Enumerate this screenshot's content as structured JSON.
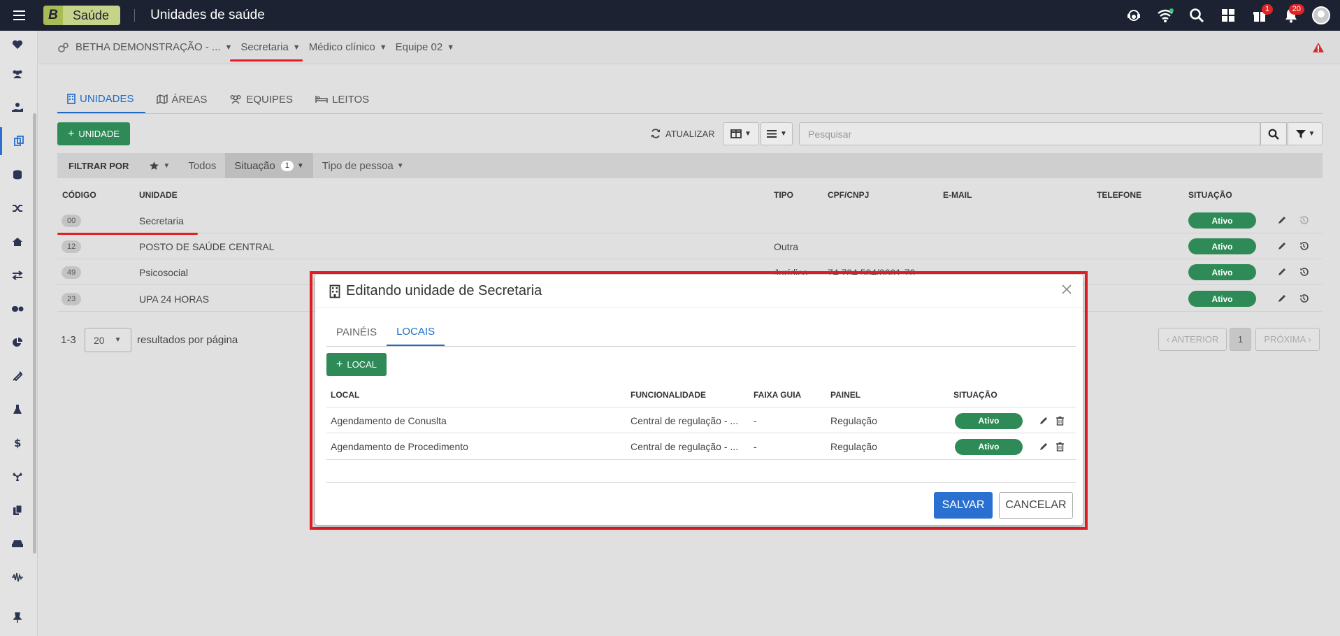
{
  "header": {
    "brand_letter": "B",
    "brand_name": "Saúde",
    "title": "Unidades de saúde",
    "icons": [
      "support-icon",
      "wifi-icon",
      "search-icon",
      "grid-icon",
      "gift-icon",
      "bell-icon"
    ],
    "gift_badge": "1",
    "bell_badge": "20"
  },
  "sidebar": {
    "items": [
      "heartbeat-icon",
      "users-icon",
      "hand-user-icon",
      "copy-icon",
      "database-icon",
      "random-icon",
      "home-icon",
      "exchange-icon",
      "pills-icon",
      "pie-chart-icon",
      "syringe-icon",
      "flask-icon",
      "dollar-icon",
      "radiation-icon",
      "files-icon",
      "car-icon",
      "waveform-icon"
    ],
    "active_index": 3,
    "pin_icon": "pin-icon"
  },
  "context": {
    "org": "BETHA DEMONSTRAÇÃO - ...",
    "entity": "Secretaria",
    "profile": "Médico clínico",
    "team": "Equipe 02"
  },
  "tabs": [
    {
      "label": "UNIDADES",
      "icon": "building-icon",
      "active": true
    },
    {
      "label": "ÁREAS",
      "icon": "map-icon",
      "active": false
    },
    {
      "label": "EQUIPES",
      "icon": "users-icon",
      "active": false
    },
    {
      "label": "LEITOS",
      "icon": "bed-icon",
      "active": false
    }
  ],
  "toolbar": {
    "add_label": "UNIDADE",
    "refresh_label": "ATUALIZAR",
    "search_placeholder": "Pesquisar"
  },
  "filters": {
    "label": "FILTRAR POR",
    "all": "Todos",
    "situation": "Situação",
    "situation_count": "1",
    "person_type": "Tipo de pessoa"
  },
  "table": {
    "columns": [
      "CÓDIGO",
      "UNIDADE",
      "TIPO",
      "CPF/CNPJ",
      "E-MAIL",
      "TELEFONE",
      "SITUAÇÃO"
    ],
    "rows": [
      {
        "code": "00",
        "name": "Secretaria",
        "type": "",
        "doc": "",
        "status": "Ativo"
      },
      {
        "code": "12",
        "name": "POSTO DE SAÚDE CENTRAL",
        "type": "Outra",
        "doc": "",
        "status": "Ativo"
      },
      {
        "code": "49",
        "name": "Psicosocial",
        "type": "Jurídica",
        "doc": "74.704.504/0001-70",
        "status": "Ativo"
      },
      {
        "code": "23",
        "name": "UPA 24 HORAS",
        "type": "",
        "doc": "",
        "status": "Ativo"
      }
    ]
  },
  "pagination": {
    "range": "1-3",
    "page_size": "20",
    "per_page_label": "resultados por página",
    "prev": "ANTERIOR",
    "current": "1",
    "next": "PRÓXIMA"
  },
  "modal": {
    "title": "Editando unidade de Secretaria",
    "tabs": [
      {
        "label": "PAINÉIS",
        "active": false
      },
      {
        "label": "LOCAIS",
        "active": true
      }
    ],
    "add_label": "LOCAL",
    "columns": [
      "LOCAL",
      "FUNCIONALIDADE",
      "FAIXA GUIA",
      "PAINEL",
      "SITUAÇÃO"
    ],
    "rows": [
      {
        "local": "Agendamento de Conuslta",
        "func": "Central de regulação - ...",
        "faixa": "-",
        "painel": "Regulação",
        "status": "Ativo"
      },
      {
        "local": "Agendamento de Procedimento",
        "func": "Central de regulação - ...",
        "faixa": "-",
        "painel": "Regulação",
        "status": "Ativo"
      }
    ],
    "save": "SALVAR",
    "cancel": "CANCELAR"
  }
}
